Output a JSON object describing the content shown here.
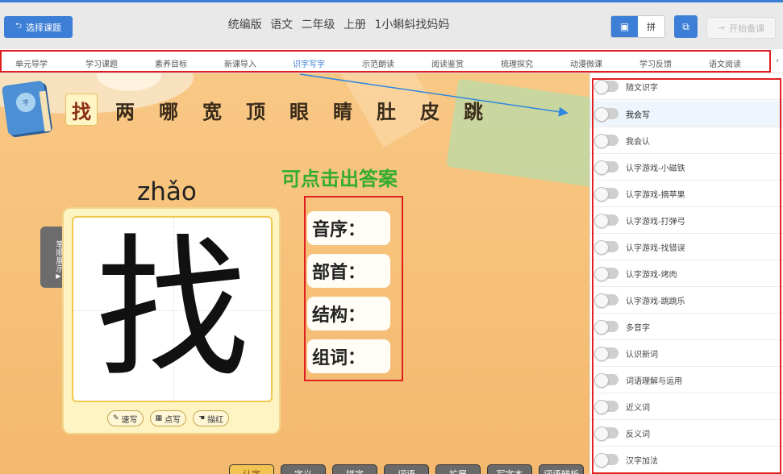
{
  "header": {
    "select_label": "选择课题",
    "title": [
      "统编版",
      "语文",
      "二年级",
      "上册",
      "1小蝌蚪找妈妈"
    ],
    "view_toggle_b": "拼",
    "start_label": "开始备课"
  },
  "nav": {
    "items": [
      "单元导学",
      "学习课题",
      "素养目标",
      "新课导入",
      "识字写字",
      "示范朗读",
      "阅读鉴赏",
      "梳理探究",
      "动漫微课",
      "学习反馈",
      "语文阅读"
    ],
    "active_index": 4
  },
  "stage": {
    "book_badge": "字",
    "chars": [
      "找",
      "两",
      "哪",
      "宽",
      "顶",
      "眼",
      "睛",
      "肚",
      "皮",
      "跳"
    ],
    "active_char_index": 0,
    "hint": "可点击出答案",
    "pinyin": "zhǎo",
    "stroke_tab": "笔顺展示",
    "big_char": "找",
    "card_buttons": [
      "速写",
      "点写",
      "描红"
    ],
    "answers": [
      "音序：",
      "部首：",
      "结构：",
      "组词："
    ],
    "bottom_buttons": [
      "认字",
      "字义",
      "拼字",
      "词语",
      "扩展",
      "写字本",
      "词语辨析"
    ],
    "active_bottom_index": 0
  },
  "panel": {
    "items": [
      "随文识字",
      "我会写",
      "我会认",
      "认字游戏-小磁铁",
      "认字游戏-摘苹果",
      "认字游戏-打弹弓",
      "认字游戏-找错误",
      "认字游戏-烤肉",
      "认字游戏-跳跳乐",
      "多音字",
      "认识新词",
      "词语理解与运用",
      "近义词",
      "反义词",
      "汉字加法"
    ],
    "selected_index": 1
  },
  "colors": {
    "accent": "#3d7fd6",
    "highlight_box": "#e02020",
    "hint_green": "#34ad2e",
    "stage_bg": "#f7c27b"
  }
}
